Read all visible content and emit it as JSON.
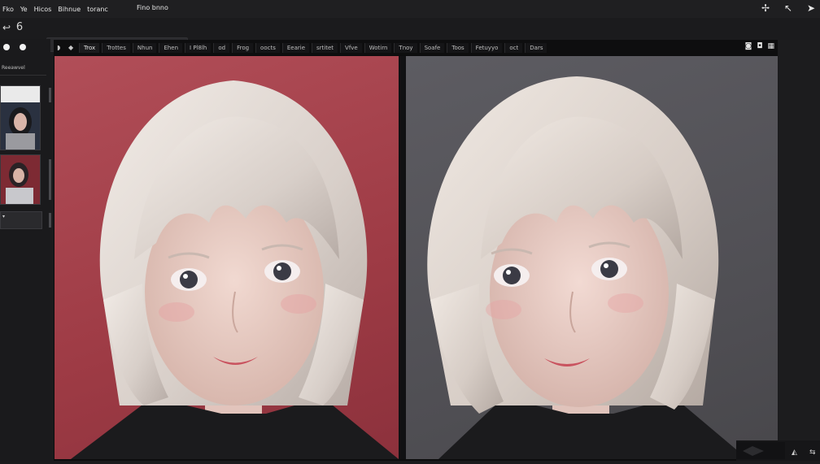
{
  "menu": {
    "items": [
      "Fko",
      "Ye",
      "Hicos",
      "Bihnue",
      "toranc"
    ],
    "center_label": "Fino bnno"
  },
  "toolbar": {
    "layer_label": "6"
  },
  "left_panel": {
    "header": "Reeawvel"
  },
  "tabs": {
    "items": [
      "Trox",
      "Trottes",
      "Nhun",
      "Ehen",
      "I Pl8lh",
      "od",
      "Frog",
      "oocts",
      "Eearie",
      "srtitet",
      "Vfve",
      "Wotirn",
      "Tnoy",
      "Soafe",
      "Toos",
      "Fetuyyo",
      "oct",
      "Dars"
    ]
  },
  "image_panes": {
    "left_background": "#b14e58",
    "right_background": "#5d5c62"
  }
}
